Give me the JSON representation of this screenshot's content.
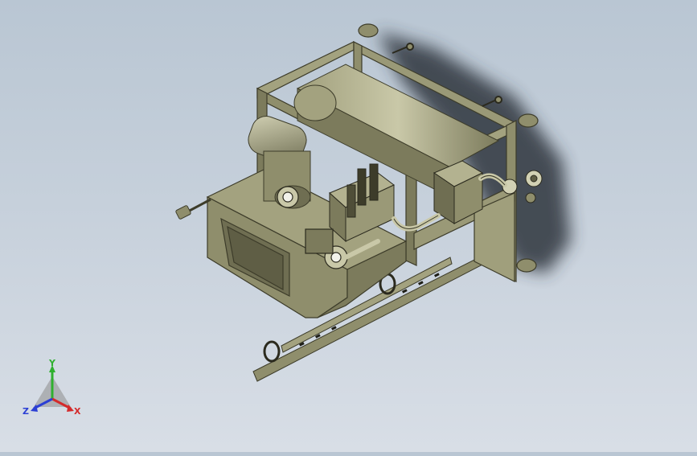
{
  "viewport": {
    "background_top": "#b9c6d3",
    "background_bottom": "#d8dee6",
    "model_color": "#8f8e6c",
    "model_dark": "#5f5e45",
    "model_light": "#b3b290",
    "shadow_color": "#2f353c"
  },
  "triad": {
    "x_label": "X",
    "y_label": "Y",
    "z_label": "Z",
    "x_color": "#d42b2b",
    "y_color": "#2fb02f",
    "z_color": "#2b3fd4"
  }
}
